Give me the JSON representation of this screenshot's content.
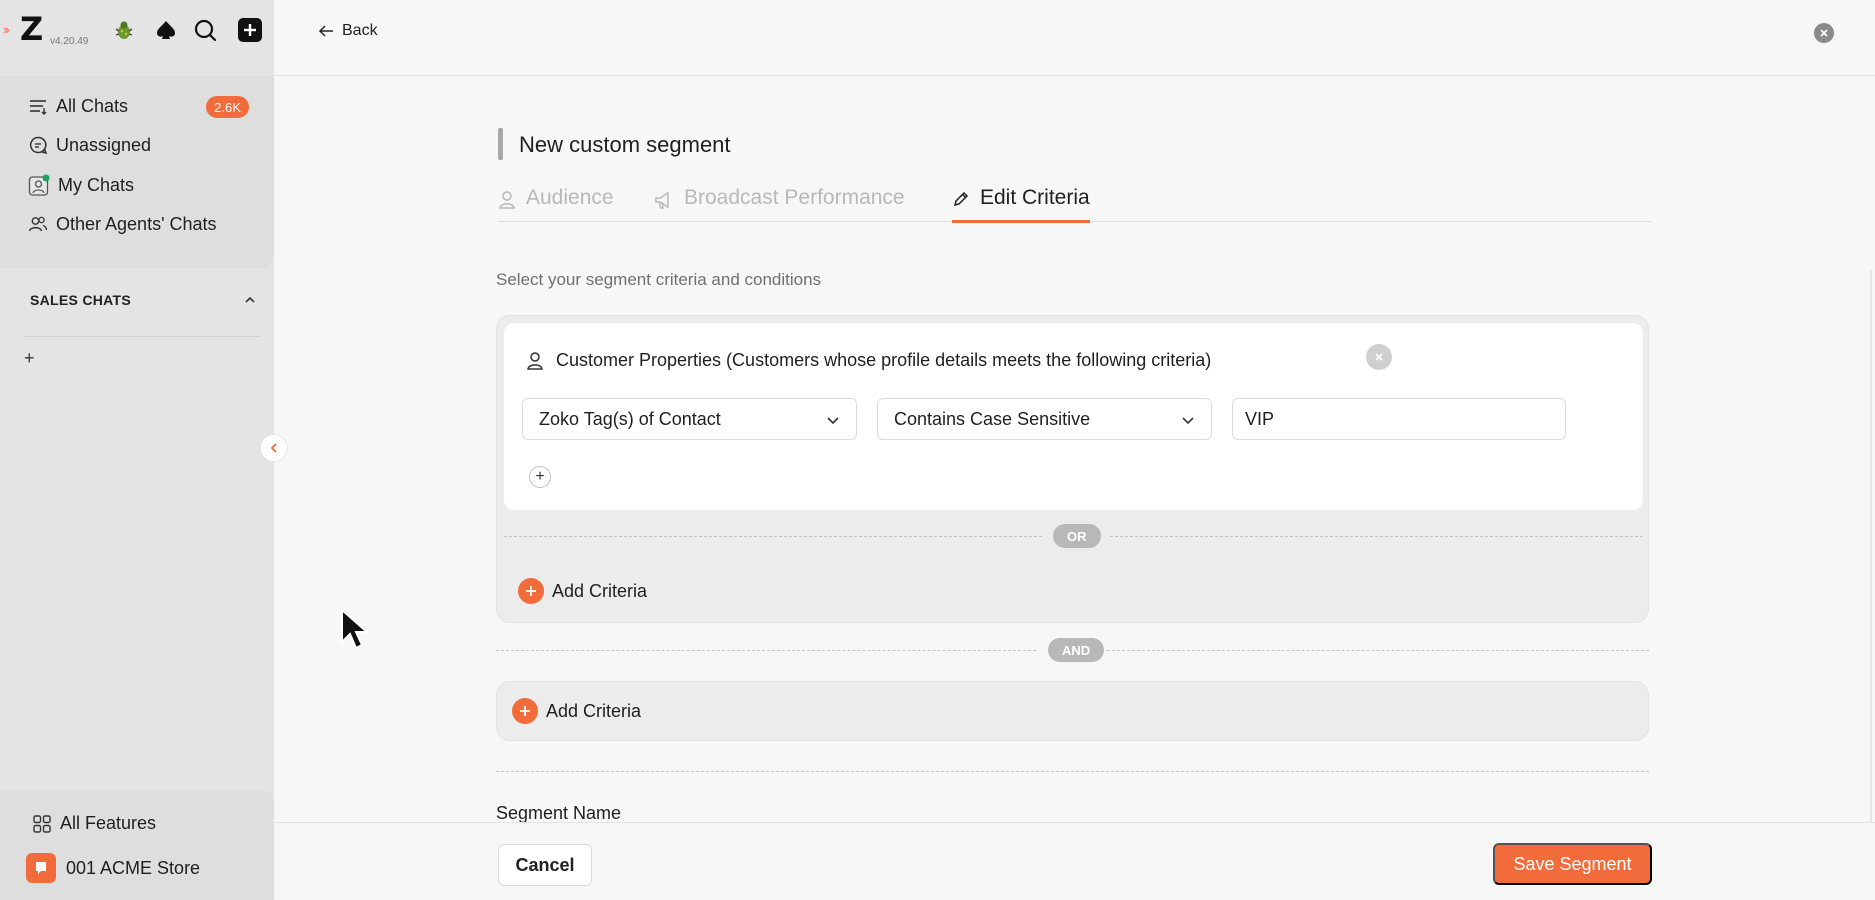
{
  "app": {
    "version": "v4.20.49",
    "accent_color": "#f26b3a"
  },
  "sidebar": {
    "nav": [
      {
        "label": "All Chats",
        "icon": "filter-list-icon",
        "badge": "2.6K"
      },
      {
        "label": "Unassigned",
        "icon": "chat-bubble-icon"
      },
      {
        "label": "My Chats",
        "icon": "user-avatar-online-icon"
      },
      {
        "label": "Other Agents' Chats",
        "icon": "users-icon"
      }
    ],
    "section_title": "SALES CHATS",
    "section_add": "+",
    "all_features": "All Features",
    "store_name": "001 ACME Store"
  },
  "header": {
    "back_label": "Back"
  },
  "page": {
    "title": "New custom segment",
    "tabs": [
      {
        "label": "Audience",
        "icon": "user-icon",
        "active": false
      },
      {
        "label": "Broadcast Performance",
        "icon": "megaphone-icon",
        "active": false
      },
      {
        "label": "Edit Criteria",
        "icon": "pencil-icon",
        "active": true
      }
    ],
    "subtitle": "Select your segment criteria and conditions"
  },
  "criteria": {
    "group1": {
      "heading": "Customer Properties (Customers whose profile details meets the following criteria)",
      "field": "Zoko Tag(s) of Contact",
      "operator": "Contains Case Sensitive",
      "value": "VIP",
      "or_label": "OR",
      "add_label": "Add Criteria"
    },
    "and_label": "AND",
    "group2": {
      "add_label": "Add Criteria"
    }
  },
  "segment_name_label": "Segment Name",
  "footer": {
    "cancel_label": "Cancel",
    "save_label": "Save Segment"
  }
}
